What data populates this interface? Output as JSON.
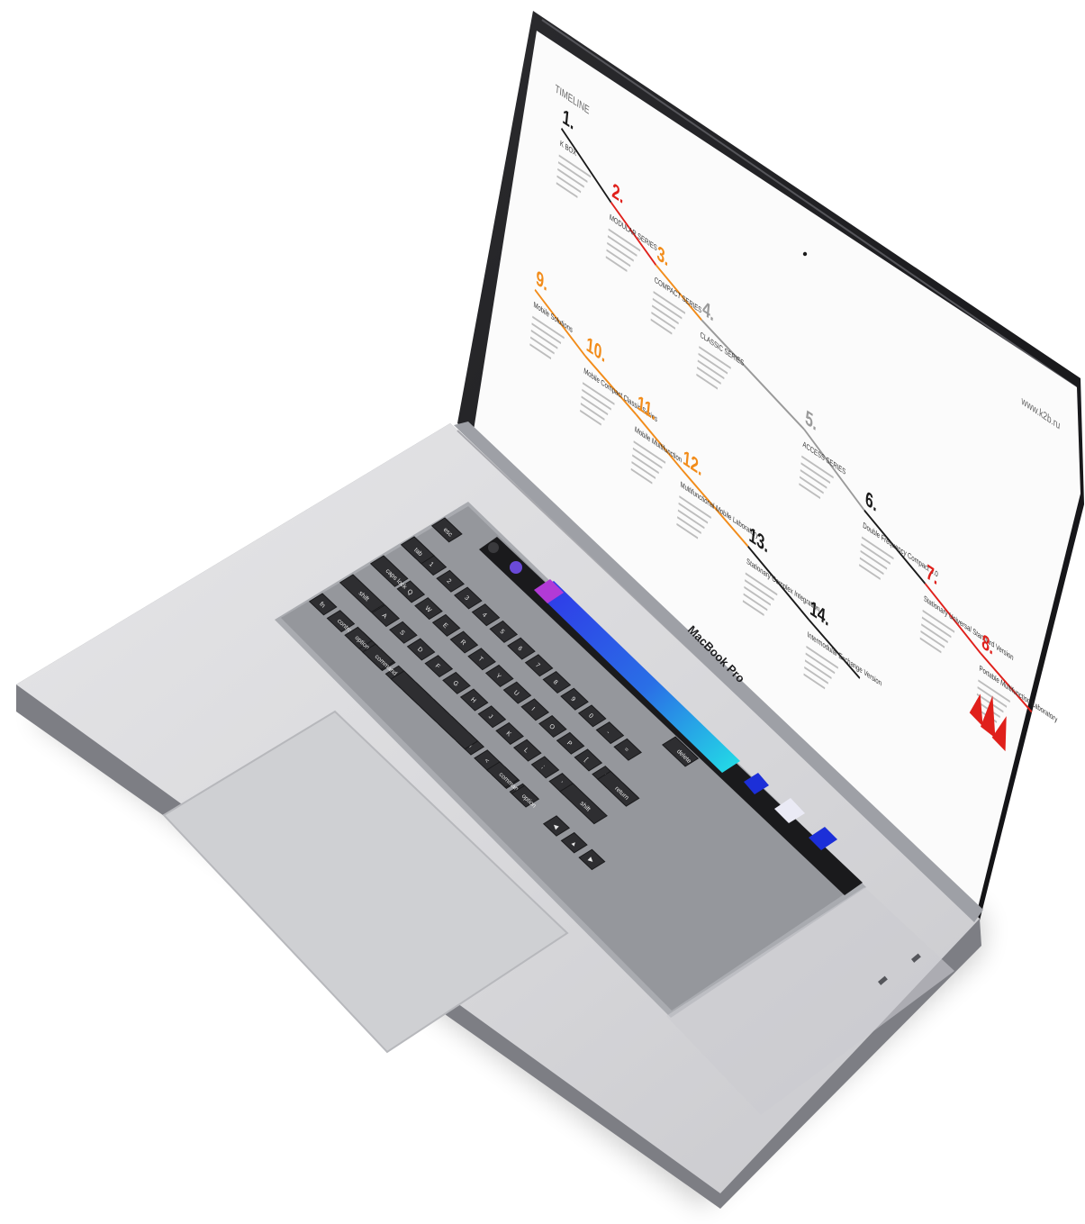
{
  "device": {
    "model_label": "MacBook Pro",
    "touch_bar_colors": [
      "#b23ad6",
      "#2a3cf0",
      "#23d8e6",
      "#1c2fd8",
      "#ffffff"
    ]
  },
  "screen": {
    "header_left": "TIMELINE",
    "header_right": "www.k2b.ru",
    "brand_color": "#e0201b",
    "timeline": [
      {
        "num": "1.",
        "color": "#1a1a1a",
        "title": "K BOX"
      },
      {
        "num": "2.",
        "color": "#e0201b",
        "title": "MODULAR SERIES"
      },
      {
        "num": "3.",
        "color": "#f28c1a",
        "title": "COMPACT SERIES"
      },
      {
        "num": "4.",
        "color": "#9a9a9a",
        "title": "CLASSIC SERIES"
      },
      {
        "num": "5.",
        "color": "#9a9a9a",
        "title": "ACCESS SERIES"
      },
      {
        "num": "6.",
        "color": "#1a1a1a",
        "title": "Double Frequency Compact 3.0"
      },
      {
        "num": "7.",
        "color": "#e0201b",
        "title": "Stationary Universal Standard Version"
      },
      {
        "num": "8.",
        "color": "#e0201b",
        "title": "Portable Multifunction Laboratory"
      },
      {
        "num": "9.",
        "color": "#f28c1a",
        "title": "Mobile Solutions"
      },
      {
        "num": "10.",
        "color": "#f28c1a",
        "title": "Mobile Compact Classic Series"
      },
      {
        "num": "11.",
        "color": "#f28c1a",
        "title": "Mobile Multifunction"
      },
      {
        "num": "12.",
        "color": "#f28c1a",
        "title": "Multifunctional Mobile Laboratory"
      },
      {
        "num": "13.",
        "color": "#1a1a1a",
        "title": "Stationary Complex Integration"
      },
      {
        "num": "14.",
        "color": "#1a1a1a",
        "title": "Intermodular Exchange Version"
      }
    ]
  },
  "keyboard": {
    "labels": {
      "esc": "esc",
      "tab": "tab",
      "caps": "caps lock",
      "shift_l": "shift",
      "fn": "fn",
      "control": "control",
      "option_l": "option",
      "command_l": "command",
      "command_r": "command",
      "option_r": "option",
      "delete": "delete",
      "return": "return",
      "shift_r": "shift"
    },
    "rows": [
      [
        "~",
        "1",
        "2",
        "3",
        "4",
        "5",
        "6",
        "7",
        "8",
        "9",
        "0",
        "-",
        "="
      ],
      [
        "Q",
        "W",
        "E",
        "R",
        "T",
        "Y",
        "U",
        "I",
        "O",
        "P",
        "[",
        "]",
        "\\"
      ],
      [
        "A",
        "S",
        "D",
        "F",
        "G",
        "H",
        "J",
        "K",
        "L",
        ";",
        "'"
      ],
      [
        "Z",
        "X",
        "C",
        "V",
        "B",
        "N",
        "M",
        "<",
        ">",
        "?"
      ]
    ]
  }
}
